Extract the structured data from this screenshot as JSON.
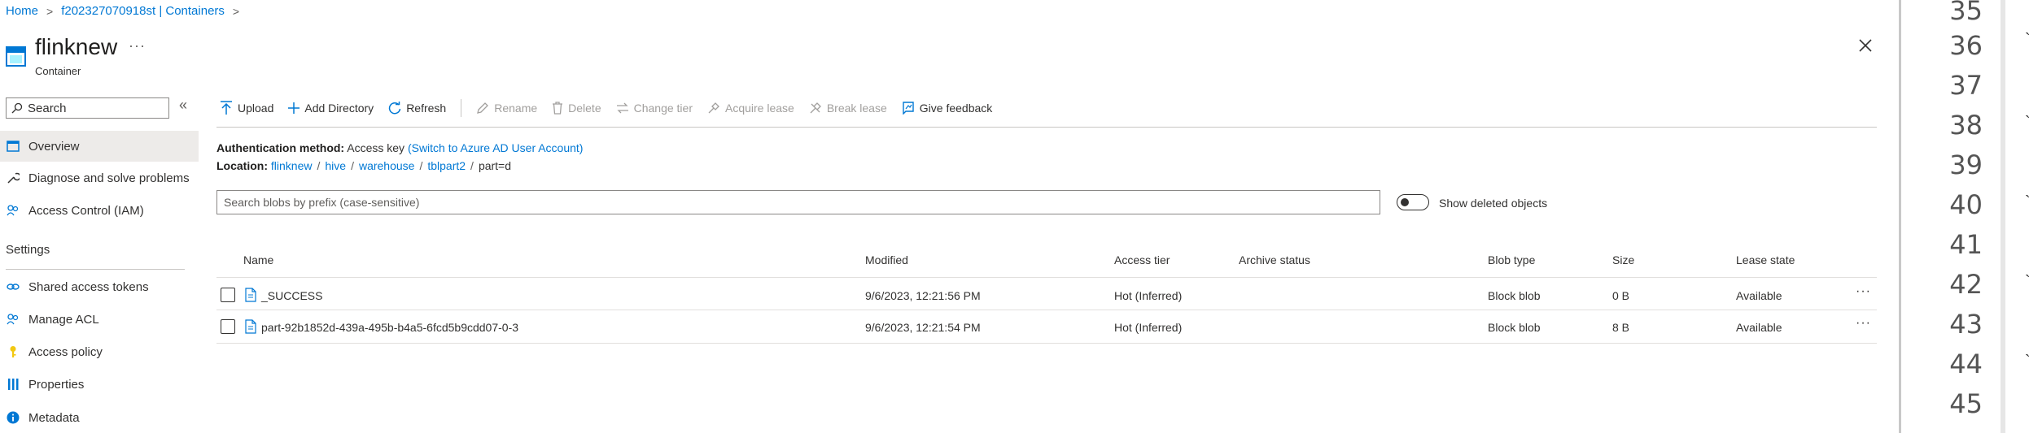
{
  "breadcrumb": {
    "items": [
      "Home",
      "f202327070918st | Containers"
    ]
  },
  "header": {
    "title": "flinknew",
    "more": "···",
    "subtitle": "Container"
  },
  "sidebar": {
    "search_placeholder": "Search",
    "collapse": "«",
    "items": [
      {
        "label": "Overview",
        "icon": "overview-icon",
        "active": true
      },
      {
        "label": "Diagnose and solve problems",
        "icon": "wrench-icon"
      },
      {
        "label": "Access Control (IAM)",
        "icon": "people-icon"
      }
    ],
    "settings_header": "Settings",
    "settings_items": [
      {
        "label": "Shared access tokens",
        "icon": "link-icon"
      },
      {
        "label": "Manage ACL",
        "icon": "people-icon"
      },
      {
        "label": "Access policy",
        "icon": "key-icon"
      },
      {
        "label": "Properties",
        "icon": "properties-icon"
      },
      {
        "label": "Metadata",
        "icon": "info-icon"
      }
    ]
  },
  "toolbar": {
    "upload": "Upload",
    "add_directory": "Add Directory",
    "refresh": "Refresh",
    "rename": "Rename",
    "delete": "Delete",
    "change_tier": "Change tier",
    "acquire_lease": "Acquire lease",
    "break_lease": "Break lease",
    "give_feedback": "Give feedback"
  },
  "auth": {
    "label": "Authentication method:",
    "value": "Access key",
    "switch_link": "(Switch to Azure AD User Account)"
  },
  "location": {
    "label": "Location:",
    "path": [
      "flinknew",
      "hive",
      "warehouse",
      "tblpart2"
    ],
    "current": "part=d"
  },
  "filter": {
    "placeholder": "Search blobs by prefix (case-sensitive)",
    "toggle_label": "Show deleted objects"
  },
  "table": {
    "columns": [
      "Name",
      "Modified",
      "Access tier",
      "Archive status",
      "Blob type",
      "Size",
      "Lease state"
    ],
    "rows": [
      {
        "name": "_SUCCESS",
        "modified": "9/6/2023, 12:21:56 PM",
        "access_tier": "Hot (Inferred)",
        "archive_status": "",
        "blob_type": "Block blob",
        "size": "0 B",
        "lease_state": "Available",
        "more": "···"
      },
      {
        "name": "part-92b1852d-439a-495b-b4a5-6fcd5b9cdd07-0-3",
        "modified": "9/6/2023, 12:21:54 PM",
        "access_tier": "Hot (Inferred)",
        "archive_status": "",
        "blob_type": "Block blob",
        "size": "8 B",
        "lease_state": "Available",
        "more": "···"
      }
    ]
  },
  "editor": {
    "line_numbers": [
      "35",
      "36",
      "37",
      "38",
      "39",
      "40",
      "41",
      "42",
      "43",
      "44",
      "45"
    ]
  },
  "colors": {
    "accent": "#0078d4",
    "active_nav": "#edebe9"
  }
}
